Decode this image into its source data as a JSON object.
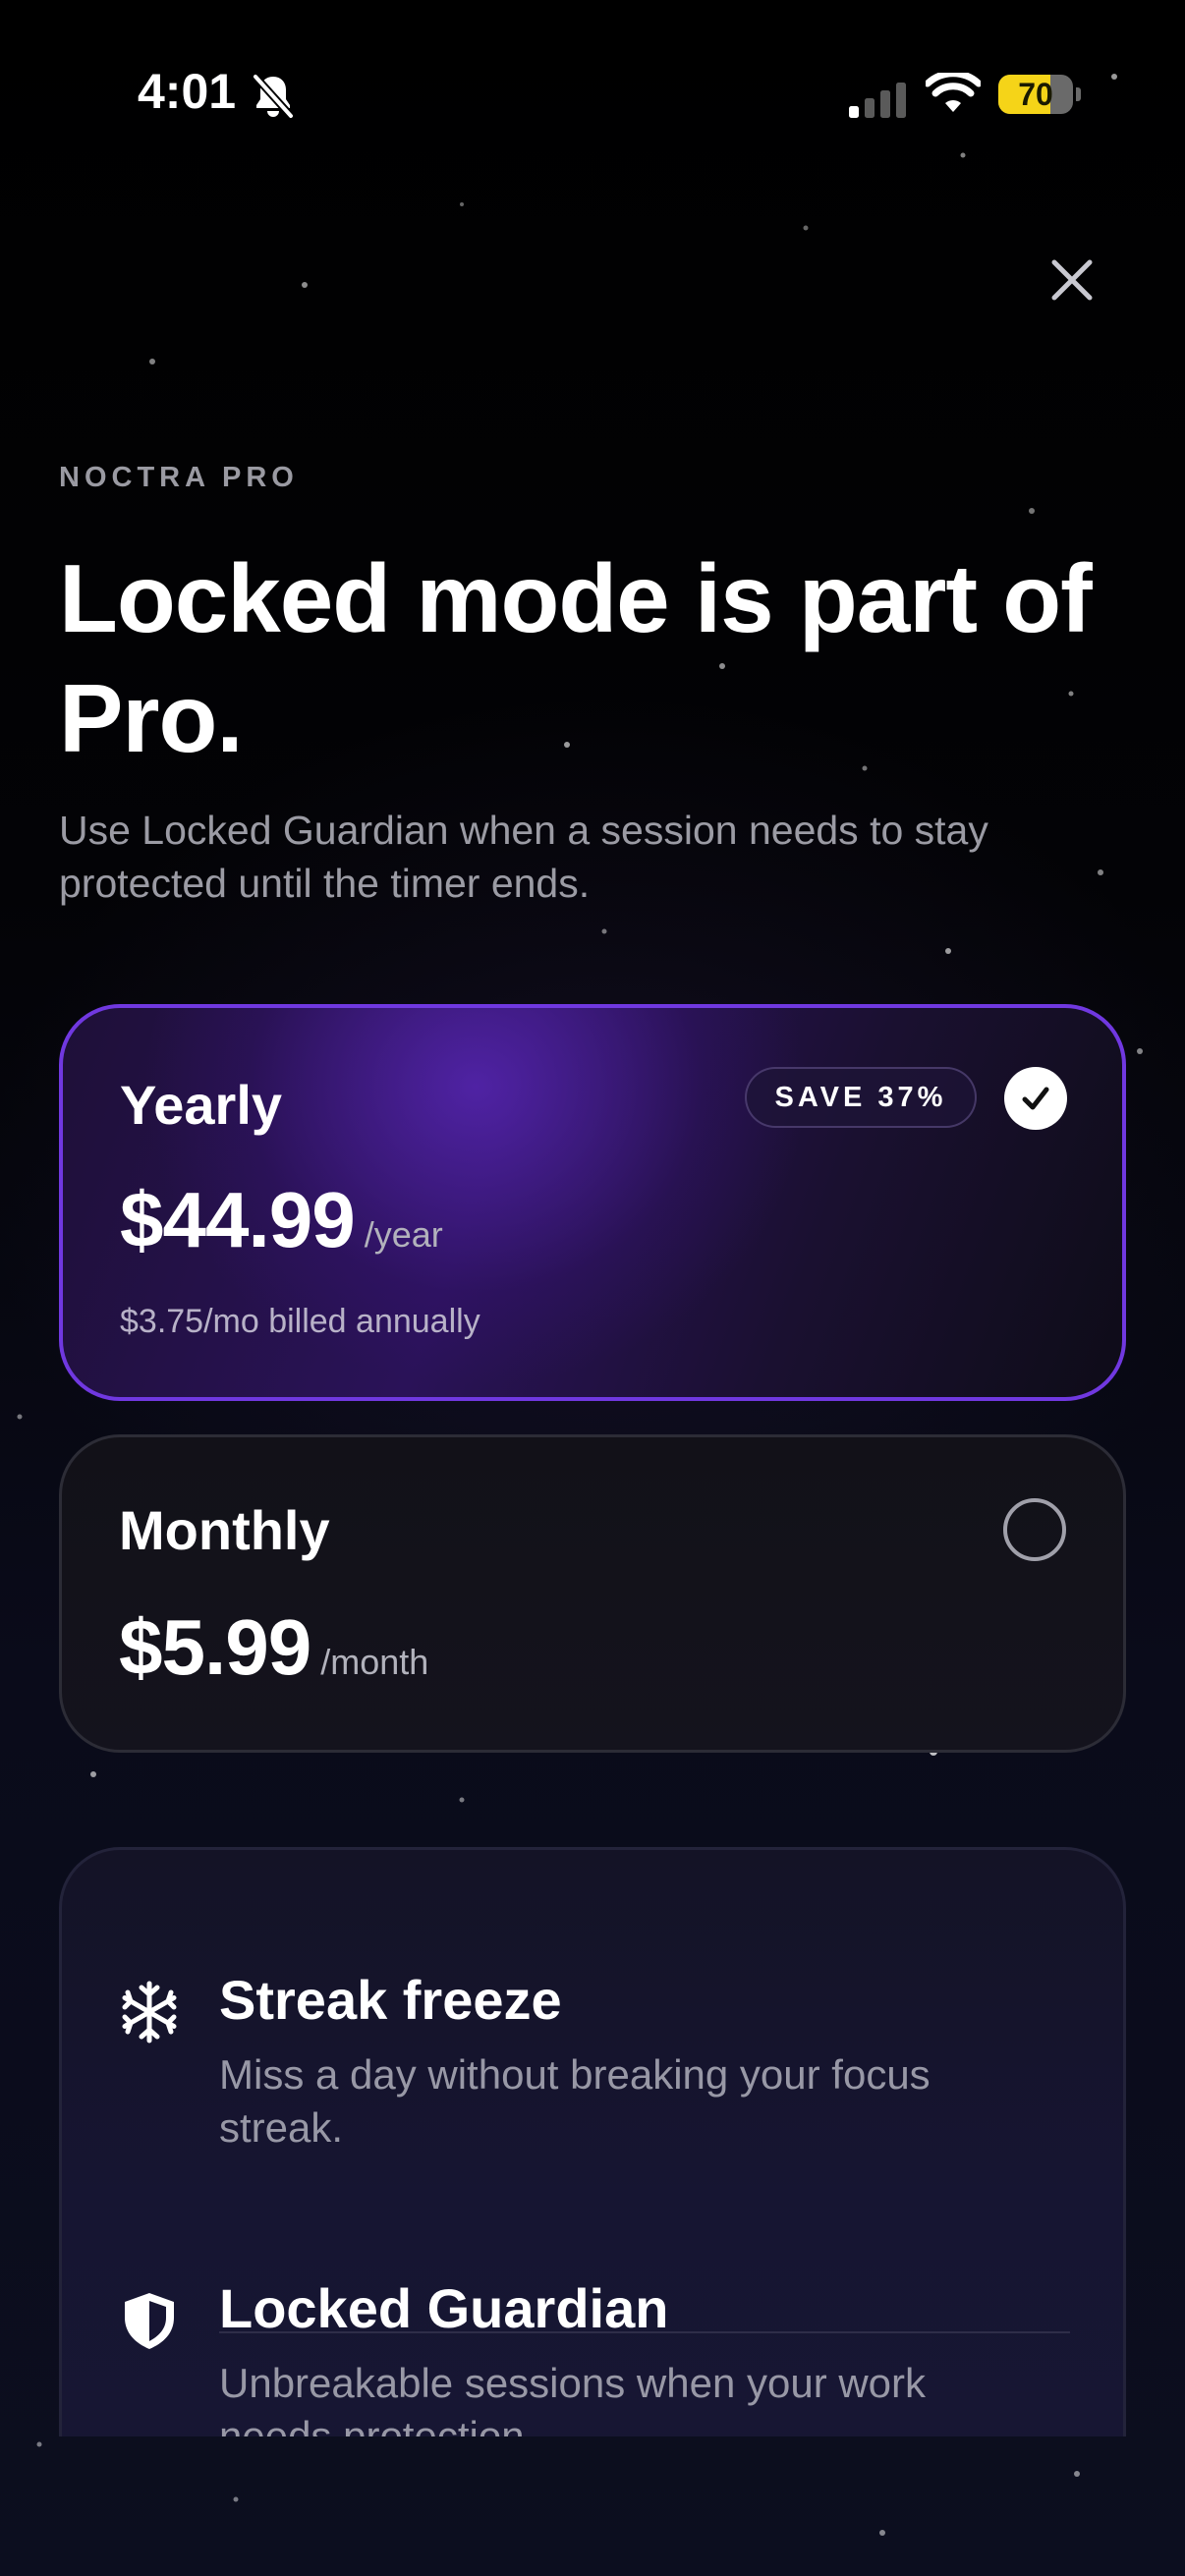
{
  "status_bar": {
    "time": "4:01",
    "battery": "70",
    "battery_level": 0.7,
    "battery_color": "#f5d418"
  },
  "header": {
    "eyebrow": "NOCTRA PRO",
    "headline": "Locked mode is part of Pro.",
    "subtitle": "Use Locked Guardian when a session needs to stay protected until the timer ends."
  },
  "plans": {
    "yearly": {
      "name": "Yearly",
      "badge": "SAVE 37%",
      "price": "$44.99",
      "period": "/year",
      "note": "$3.75/mo billed annually",
      "selected": true
    },
    "monthly": {
      "name": "Monthly",
      "price": "$5.99",
      "period": "/month",
      "selected": false
    }
  },
  "features": [
    {
      "icon": "snowflake-icon",
      "title": "Streak freeze",
      "description": "Miss a day without breaking your focus streak."
    },
    {
      "icon": "shield-icon",
      "title": "Locked Guardian",
      "description": "Unbreakable sessions when your work needs protection."
    }
  ],
  "colors": {
    "accent": "#7038e0",
    "background": "#000000",
    "muted_text": "#9b9ba4"
  }
}
